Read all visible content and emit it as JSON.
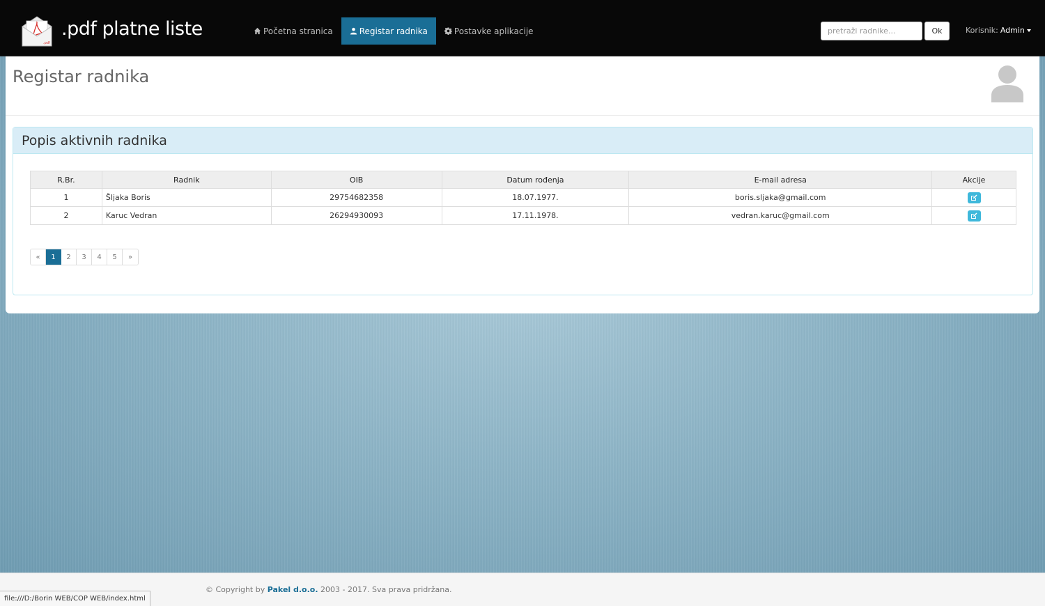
{
  "navbar": {
    "brand": ".pdf platne liste",
    "items": [
      {
        "label": "Početna stranica",
        "icon": "home-icon",
        "active": false
      },
      {
        "label": "Registar radnika",
        "icon": "user-icon",
        "active": true
      },
      {
        "label": "Postavke aplikacije",
        "icon": "gear-icon",
        "active": false
      }
    ],
    "search": {
      "placeholder": "pretraži radnike...",
      "button_label": "Ok"
    },
    "user": {
      "prefix": "Korisnik:",
      "name": "Admin"
    }
  },
  "page": {
    "title": "Registar radnika",
    "panel_title": "Popis aktivnih radnika"
  },
  "table": {
    "columns": [
      "R.Br.",
      "Radnik",
      "OIB",
      "Datum rođenja",
      "E-mail adresa",
      "Akcije"
    ],
    "rows": [
      {
        "rbr": "1",
        "radnik": "Šljaka Boris",
        "oib": "29754682358",
        "datum": "18.07.1977.",
        "email": "boris.sljaka@gmail.com"
      },
      {
        "rbr": "2",
        "radnik": "Karuc Vedran",
        "oib": "26294930093",
        "datum": "17.11.1978.",
        "email": "vedran.karuc@gmail.com"
      }
    ]
  },
  "pagination": {
    "prev": "«",
    "pages": [
      "1",
      "2",
      "3",
      "4",
      "5"
    ],
    "active": "1",
    "next": "»"
  },
  "footer": {
    "prefix": "© Copyright by",
    "company": "Pakel d.o.o.",
    "suffix": "2003 - 2017. Sva prava pridržana."
  },
  "statusbar": {
    "url": "file:///D:/Borin WEB/COP WEB/index.html"
  },
  "colors": {
    "accent": "#1a6e96",
    "panel_heading": "#d9edf7",
    "action_button": "#3fb8db"
  }
}
